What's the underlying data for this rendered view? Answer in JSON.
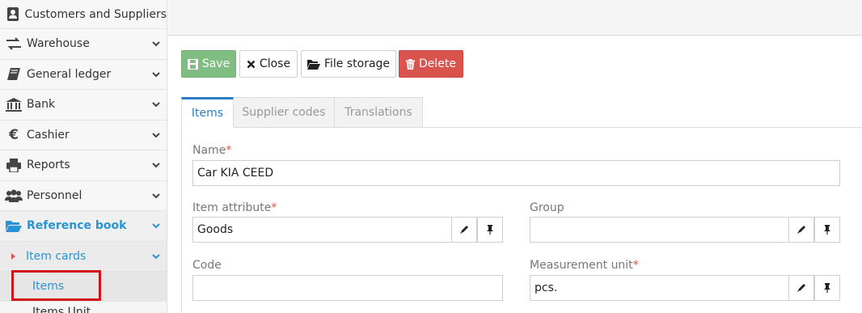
{
  "sidebar": {
    "items": [
      {
        "label": "Customers and Suppliers",
        "icon": "address-book-icon"
      },
      {
        "label": "Warehouse",
        "icon": "exchange-icon"
      },
      {
        "label": "General ledger",
        "icon": "book-icon"
      },
      {
        "label": "Bank",
        "icon": "bank-icon"
      },
      {
        "label": "Cashier",
        "icon": "euro-icon"
      },
      {
        "label": "Reports",
        "icon": "printer-icon"
      },
      {
        "label": "Personnel",
        "icon": "users-icon"
      },
      {
        "label": "Reference book",
        "icon": "folder-open-icon"
      }
    ],
    "submenu": {
      "label": "Item cards"
    },
    "leaf": {
      "label": "Items"
    },
    "cut_label": "Items Unit ..."
  },
  "toolbar": {
    "save_label": "Save",
    "close_label": "Close",
    "files_label": "File storage",
    "delete_label": "Delete"
  },
  "tabs": [
    {
      "label": "Items",
      "active": true
    },
    {
      "label": "Supplier codes",
      "active": false
    },
    {
      "label": "Translations",
      "active": false
    }
  ],
  "form": {
    "name": {
      "label": "Name",
      "required": "*",
      "value": "Car KIA CEED"
    },
    "item_attribute": {
      "label": "Item attribute",
      "required": "*",
      "value": "Goods"
    },
    "group": {
      "label": "Group",
      "value": ""
    },
    "code": {
      "label": "Code",
      "value": ""
    },
    "measurement_unit": {
      "label": "Measurement unit",
      "required": "*",
      "value": "pcs."
    }
  },
  "colors": {
    "accent": "#2a93d5",
    "save": "#80bd82",
    "delete": "#d9534f",
    "highlight": "#d0121b"
  }
}
